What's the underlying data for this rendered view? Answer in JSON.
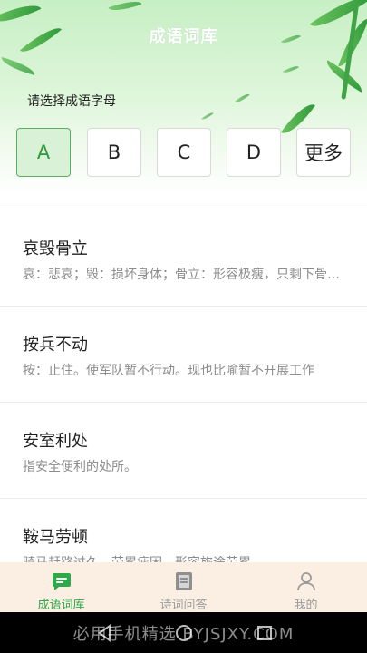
{
  "app": {
    "title": "成语词库"
  },
  "selector": {
    "prompt": "请选择成语字母",
    "letters": [
      "A",
      "B",
      "C",
      "D",
      "更多"
    ],
    "selected": "A"
  },
  "idioms": [
    {
      "title": "哀毁骨立",
      "desc": "哀：悲哀；毁：损坏身体；骨立：形容极瘦，只剩下骨架。旧时形容父母死后悲伤过度的样子"
    },
    {
      "title": "按兵不动",
      "desc": "按：止住。使军队暂不行动。现也比喻暂不开展工作"
    },
    {
      "title": "安室利处",
      "desc": "指安全便利的处所。"
    },
    {
      "title": "鞍马劳顿",
      "desc": "骑马赶路过久，劳累疲困。形容旅途劳累。"
    }
  ],
  "bottom_nav": {
    "items": [
      {
        "label": "成语词库",
        "icon": "chat-bubble-icon",
        "active": true
      },
      {
        "label": "诗词问答",
        "icon": "book-answer-icon",
        "active": false
      },
      {
        "label": "我的",
        "icon": "user-icon",
        "active": false
      }
    ],
    "active_color": "#2fa84a",
    "inactive_color": "#9a9a9a"
  },
  "system_bar": {
    "watermark": "必用手机精选 BYJSJXY.COM"
  },
  "colors": {
    "accent": "#2fa84a",
    "selected_bg": "#d9f1d6",
    "nav_bg": "#fbefe3"
  }
}
